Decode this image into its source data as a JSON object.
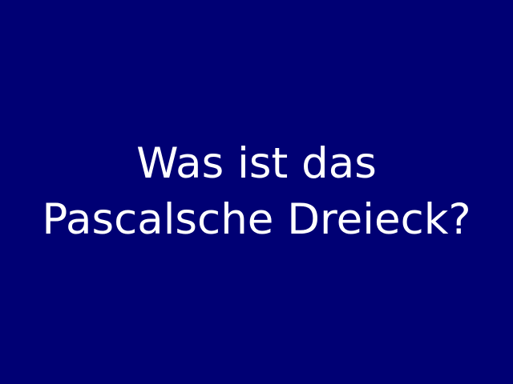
{
  "slide": {
    "background_color": "#000074",
    "text_color": "#ffffff",
    "title_lines": [
      "Was ist das",
      "Pascalsche Dreieck?"
    ]
  }
}
